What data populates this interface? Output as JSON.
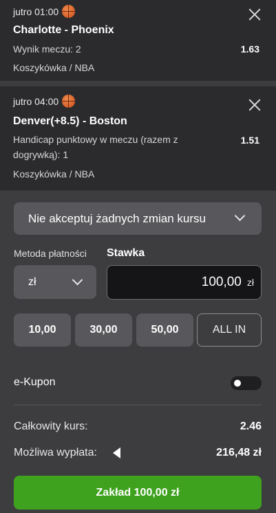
{
  "bets": [
    {
      "time": "jutro 01:00",
      "match": "Charlotte - Phoenix",
      "market": "Wynik meczu: 2",
      "odds": "1.63",
      "league": "Koszykówka / NBA"
    },
    {
      "time": "jutro 04:00",
      "match": "Denver(+8.5) - Boston",
      "market_line1": "Handicap punktowy w meczu (razem z",
      "market_line2": "dogrywką): 1",
      "odds": "1.51",
      "league": "Koszykówka / NBA"
    }
  ],
  "odds_changes_select": "Nie akceptuj żadnych zmian kursu",
  "payment_method_label": "Metoda płatności",
  "stake_label": "Stawka",
  "currency_select": "zł",
  "stake_value": "100,00",
  "stake_unit": "zł",
  "quick_amounts": [
    "10,00",
    "30,00",
    "50,00"
  ],
  "all_in_label": "ALL IN",
  "ekupon_label": "e-Kupon",
  "ekupon_enabled": false,
  "total_odds_label": "Całkowity kurs:",
  "total_odds_value": "2.46",
  "possible_payout_label": "Możliwa wypłata:",
  "possible_payout_value": "216,48 zł",
  "place_bet_label": "Zakład 100,00 zł",
  "colors": {
    "background": "#3d3d40",
    "card": "#2b2b2e",
    "control": "#58585c",
    "accent_green": "#3fa21f"
  },
  "icons": [
    "basketball-icon",
    "close-icon",
    "chevron-down-icon",
    "triangle-left-icon"
  ]
}
